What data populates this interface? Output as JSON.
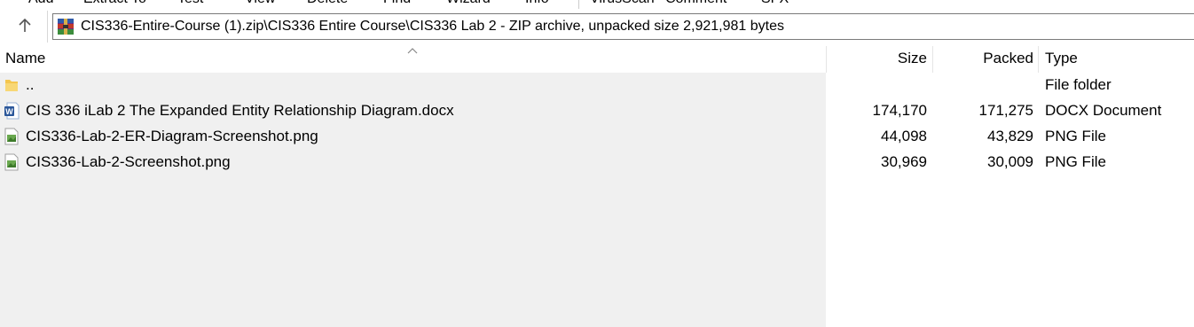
{
  "toolbar": {
    "items": [
      "Add",
      "Extract To",
      "Test",
      "View",
      "Delete",
      "Find",
      "Wizard",
      "Info",
      "VirusScan",
      "Comment",
      "SFX"
    ]
  },
  "address": {
    "path": "CIS336-Entire-Course (1).zip\\CIS336 Entire Course\\CIS336 Lab 2 - ZIP archive, unpacked size 2,921,981 bytes"
  },
  "columns": {
    "name": "Name",
    "size": "Size",
    "packed": "Packed",
    "type": "Type"
  },
  "files": [
    {
      "name": "..",
      "size": "",
      "packed": "",
      "type": "File folder",
      "icon": "folder-icon"
    },
    {
      "name": "CIS 336 iLab 2 The Expanded Entity Relationship Diagram.docx",
      "size": "174,170",
      "packed": "171,275",
      "type": "DOCX Document",
      "icon": "word-document-icon"
    },
    {
      "name": "CIS336-Lab-2-ER-Diagram-Screenshot.png",
      "size": "44,098",
      "packed": "43,829",
      "type": "PNG File",
      "icon": "png-file-icon"
    },
    {
      "name": "CIS336-Lab-2-Screenshot.png",
      "size": "30,969",
      "packed": "30,009",
      "type": "PNG File",
      "icon": "png-file-icon"
    }
  ],
  "colors": {
    "list_background": "#f0f0f0",
    "word_blue": "#2b579a",
    "folder_yellow": "#f4c64f",
    "png_green": "#6aa84f"
  }
}
